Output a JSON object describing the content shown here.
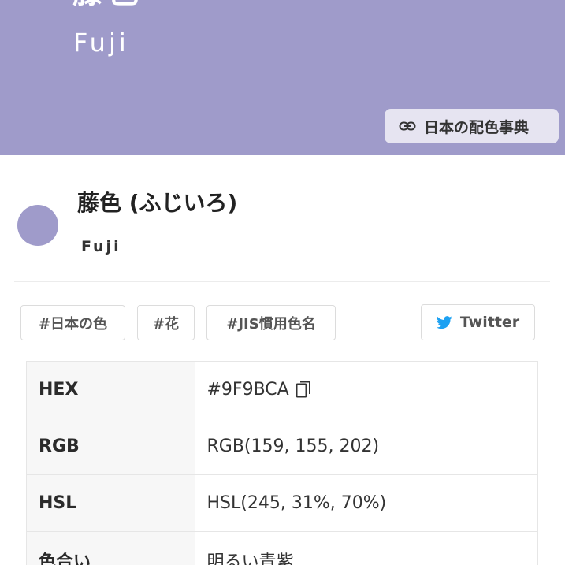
{
  "hero": {
    "kanji": "藤色",
    "romaji": "Fuji",
    "background_color": "#9F9BCA",
    "dict_button": {
      "icon": "link-icon",
      "label": "日本の配色事典"
    }
  },
  "color": {
    "name": "藤色 (ふじいろ)",
    "romaji": "Fuji",
    "swatch_color": "#9F9BCA"
  },
  "tags": [
    "#日本の色",
    "#花",
    "#JIS慣用色名"
  ],
  "share": {
    "icon": "twitter-bird-icon",
    "label": "Twitter",
    "accent": "#1DA1F2"
  },
  "table": {
    "rows": [
      {
        "key": "HEX",
        "value": "#9F9BCA",
        "icon": "copy-icon"
      },
      {
        "key": "RGB",
        "value": "RGB(159, 155, 202)"
      },
      {
        "key": "HSL",
        "value": "HSL(245, 31%, 70%)"
      },
      {
        "key": "色合い",
        "value": "明るい青紫"
      }
    ]
  }
}
